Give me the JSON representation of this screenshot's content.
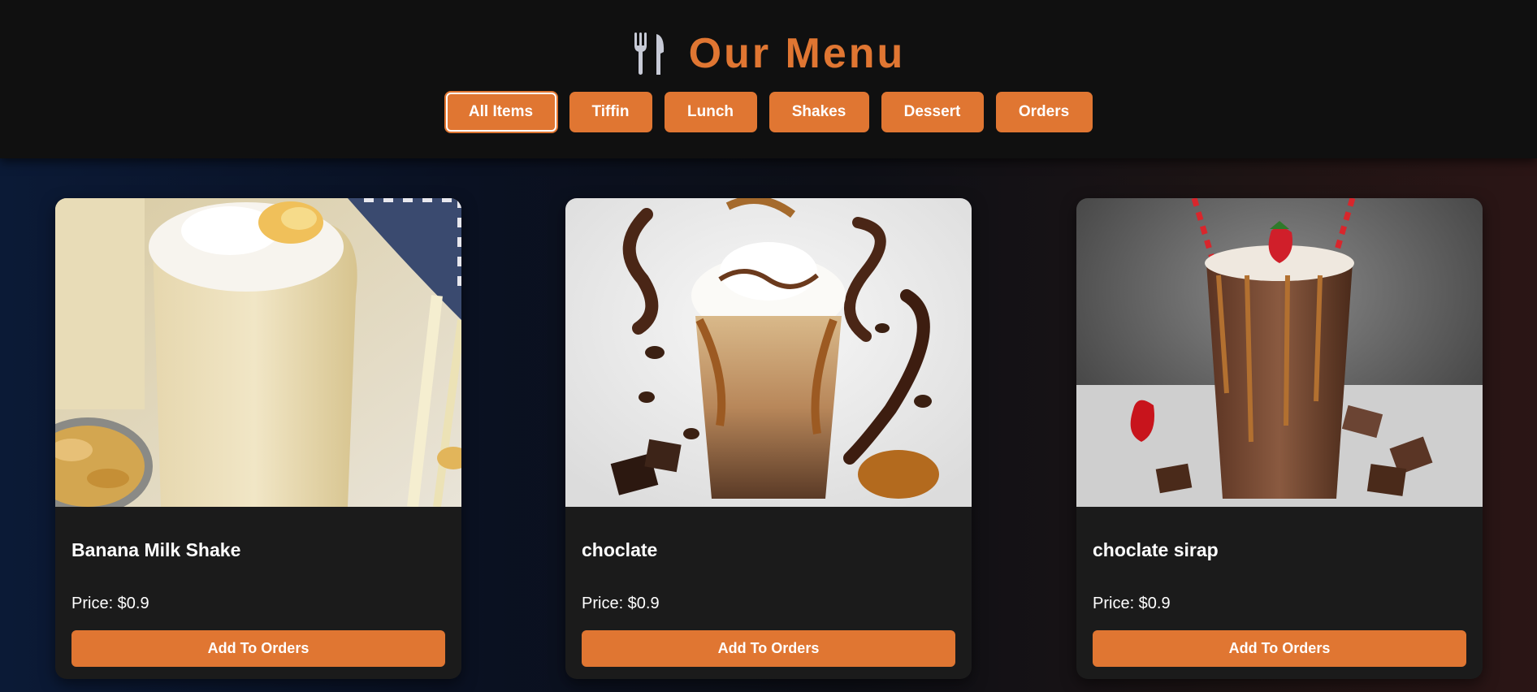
{
  "header": {
    "title": "Our Menu",
    "icon": "fork-knife-icon",
    "accent_color": "#e07632",
    "filters": [
      {
        "label": "All Items",
        "active": true
      },
      {
        "label": "Tiffin",
        "active": false
      },
      {
        "label": "Lunch",
        "active": false
      },
      {
        "label": "Shakes",
        "active": false
      },
      {
        "label": "Dessert",
        "active": false
      },
      {
        "label": "Orders",
        "active": false
      }
    ]
  },
  "menu": {
    "items": [
      {
        "name": "Banana Milk Shake",
        "price": "Price: $0.9",
        "button": "Add To Orders",
        "image": "banana-milkshake-photo"
      },
      {
        "name": "choclate",
        "price": "Price: $0.9",
        "button": "Add To Orders",
        "image": "chocolate-drink-photo"
      },
      {
        "name": "choclate sirap",
        "price": "Price: $0.9",
        "button": "Add To Orders",
        "image": "chocolate-syrup-shake-photo"
      }
    ]
  }
}
